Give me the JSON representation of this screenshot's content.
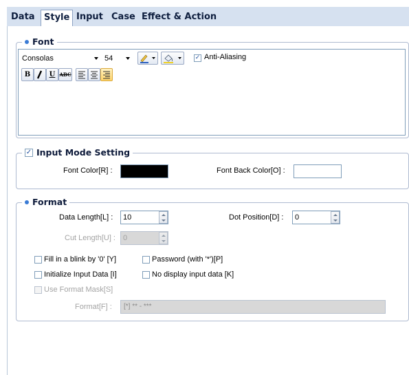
{
  "tabs": [
    {
      "label": "Data"
    },
    {
      "label": "Style"
    },
    {
      "label": "Input"
    },
    {
      "label": "Case"
    },
    {
      "label": "Effect & Action"
    }
  ],
  "font": {
    "title": "Font",
    "family": "Consolas",
    "size": "54",
    "anti_aliasing_label": "Anti-Aliasing",
    "anti_aliasing_checked": true,
    "buttons": {
      "bold": "B",
      "italic": "I",
      "underline": "U",
      "strike": "ABC"
    }
  },
  "input_mode": {
    "title": "Input Mode Setting",
    "checked": true,
    "font_color_label": "Font Color[R] :",
    "font_color_value": "#000000",
    "font_back_color_label": "Font Back Color[O] :",
    "font_back_color_value": "#ffffff"
  },
  "format": {
    "title": "Format",
    "data_length_label": "Data Length[L] :",
    "data_length_value": "10",
    "dot_position_label": "Dot Position[D] :",
    "dot_position_value": "0",
    "cut_length_label": "Cut Length[U] :",
    "cut_length_value": "0",
    "fill_blink_label": "Fill in a blink by '0' [Y]",
    "password_label": "Password (with '*')[P]",
    "initialize_label": "Initialize Input Data [I]",
    "no_display_label": "No display input data  [K]",
    "use_mask_label": "Use Format Mask[S]",
    "format_label": "Format[F] :",
    "format_value": "[*] ** - ***"
  },
  "colors": {
    "accent": "#3a7bd5",
    "tabbar": "#d6e1f0",
    "border": "#aebad0"
  }
}
